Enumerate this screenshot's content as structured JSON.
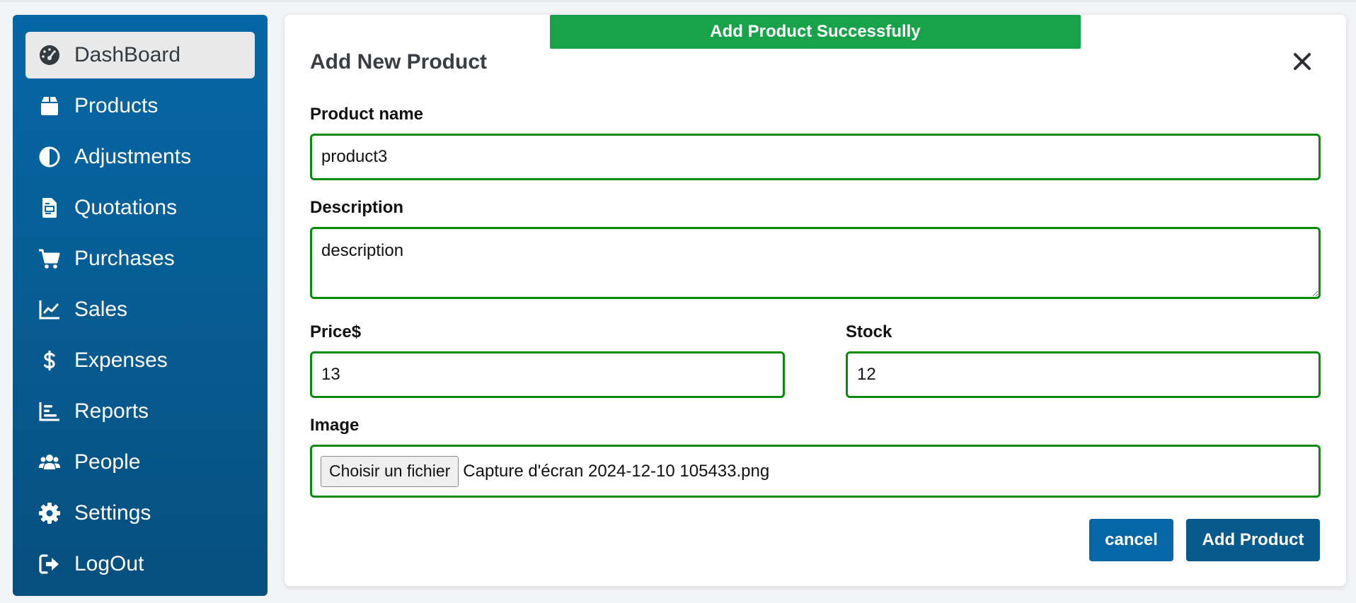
{
  "sidebar": {
    "items": [
      {
        "label": "DashBoard",
        "icon": "dashboard-gauge-icon"
      },
      {
        "label": "Products",
        "icon": "box-icon"
      },
      {
        "label": "Adjustments",
        "icon": "half-circle-icon"
      },
      {
        "label": "Quotations",
        "icon": "document-icon"
      },
      {
        "label": "Purchases",
        "icon": "cart-icon"
      },
      {
        "label": "Sales",
        "icon": "line-chart-icon"
      },
      {
        "label": "Expenses",
        "icon": "dollar-icon"
      },
      {
        "label": "Reports",
        "icon": "bar-chart-icon"
      },
      {
        "label": "People",
        "icon": "users-icon"
      },
      {
        "label": "Settings",
        "icon": "gear-icon"
      },
      {
        "label": "LogOut",
        "icon": "logout-icon"
      }
    ],
    "active": "DashBoard"
  },
  "toast": {
    "message": "Add Product Successfully",
    "color": "#18a34a"
  },
  "modal": {
    "title": "Add New Product",
    "close_icon": "close-icon",
    "fields": {
      "name": {
        "label": "Product name",
        "value": "product3"
      },
      "description": {
        "label": "Description",
        "value": "description"
      },
      "price": {
        "label": "Price$",
        "value": "13"
      },
      "stock": {
        "label": "Stock",
        "value": "12"
      },
      "image": {
        "label": "Image",
        "button_label": "Choisir un fichier",
        "file_name": "Capture d'écran 2024-12-10 105433.png"
      }
    },
    "buttons": {
      "cancel": "cancel",
      "submit": "Add Product"
    }
  },
  "colors": {
    "sidebar": "#0567a6",
    "field_border": "#0a8a0a",
    "primary_button": "#065a8c",
    "cancel_button": "#0567a6"
  }
}
